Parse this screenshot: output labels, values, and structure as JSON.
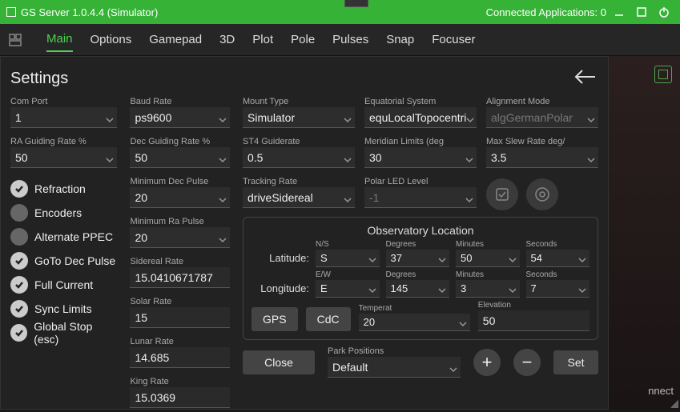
{
  "title": {
    "app": "GS Server",
    "version": "1.0.4.4",
    "mode": "(Simulator)",
    "connected_label": "Connected Applications:",
    "connected_count": "0"
  },
  "tabs": [
    "Main",
    "Options",
    "Gamepad",
    "3D",
    "Plot",
    "Pole",
    "Pulses",
    "Snap",
    "Focuser"
  ],
  "active_tab": 0,
  "panel_title": "Settings",
  "fields": {
    "com_port": {
      "label": "Com Port",
      "value": "1"
    },
    "baud": {
      "label": "Baud Rate",
      "value": "ps9600"
    },
    "mount_type": {
      "label": "Mount Type",
      "value": "Simulator"
    },
    "eq_system": {
      "label": "Equatorial System",
      "value": "equLocalTopocentri"
    },
    "align_mode": {
      "label": "Alignment Mode",
      "value": "algGermanPolar"
    },
    "ra_guide": {
      "label": "RA Guiding Rate %",
      "value": "50"
    },
    "dec_guide": {
      "label": "Dec Guiding Rate %",
      "value": "50"
    },
    "st4": {
      "label": "ST4 Guiderate",
      "value": "0.5"
    },
    "meridian": {
      "label": "Meridian Limits (deg",
      "value": "30"
    },
    "max_slew": {
      "label": "Max Slew Rate deg/",
      "value": "3.5"
    },
    "min_dec_pulse": {
      "label": "Minimum Dec Pulse",
      "value": "20"
    },
    "tracking": {
      "label": "Tracking Rate",
      "value": "driveSidereal"
    },
    "polar_led": {
      "label": "Polar LED Level",
      "value": "-1"
    },
    "min_ra_pulse": {
      "label": "Minimum Ra Pulse",
      "value": "20"
    },
    "sidereal": {
      "label": "Sidereal Rate",
      "value": "15.0410671787"
    },
    "solar": {
      "label": "Solar Rate",
      "value": "15"
    },
    "lunar": {
      "label": "Lunar Rate",
      "value": "14.685"
    },
    "king": {
      "label": "King Rate",
      "value": "15.0369"
    }
  },
  "toggles": [
    {
      "label": "Refraction",
      "on": true
    },
    {
      "label": "Encoders",
      "on": false
    },
    {
      "label": "Alternate PPEC",
      "on": false
    },
    {
      "label": "GoTo Dec Pulse",
      "on": true
    },
    {
      "label": "Full Current",
      "on": true
    },
    {
      "label": "Sync Limits",
      "on": true
    },
    {
      "label": "Global Stop (esc)",
      "on": true
    }
  ],
  "obs": {
    "title": "Observatory Location",
    "lat_label": "Latitude:",
    "lon_label": "Longitude:",
    "ns": {
      "label": "N/S",
      "value": "S"
    },
    "lat_deg": {
      "label": "Degrees",
      "value": "37"
    },
    "lat_min": {
      "label": "Minutes",
      "value": "50"
    },
    "lat_sec": {
      "label": "Seconds",
      "value": "54"
    },
    "ew": {
      "label": "E/W",
      "value": "E"
    },
    "lon_deg": {
      "label": "Degrees",
      "value": "145"
    },
    "lon_min": {
      "label": "Minutes",
      "value": "3"
    },
    "lon_sec": {
      "label": "Seconds",
      "value": "7"
    },
    "temperature": {
      "label": "Temperat",
      "value": "20"
    },
    "elevation": {
      "label": "Elevation",
      "value": "50"
    },
    "gps": "GPS",
    "cdc": "CdC"
  },
  "bottom": {
    "close": "Close",
    "park_label": "Park Positions",
    "park_value": "Default",
    "set": "Set"
  },
  "right": {
    "connect": "nnect"
  }
}
